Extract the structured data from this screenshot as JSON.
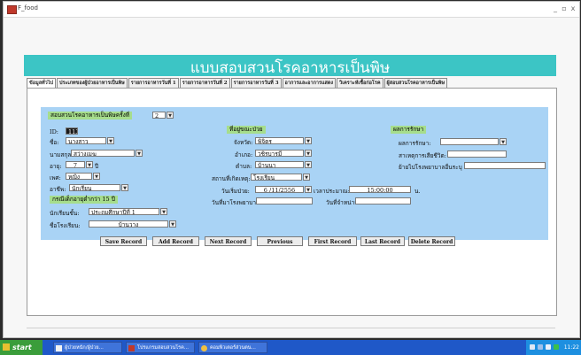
{
  "window": {
    "title": "F_food",
    "min_glyph": "_",
    "max_glyph": "▫",
    "close_glyph": "x"
  },
  "header": {
    "title": "แบบสอบสวนโรคอาหารเป็นพิษ"
  },
  "tabs": [
    "ข้อมูลทั่วไป",
    "ประเภทของผู้ป่วยอาหารเป็นพิษ",
    "รายการอาหารวันที่ 1",
    "รายการอาหารวันที่ 2",
    "รายการอาหารวันที่ 3",
    "อาการและอาการแสดง",
    "วิเคราะห์เชื้อก่อโรค",
    "ผู้สอบสวนโรคอาหารเป็นพิษ"
  ],
  "form": {
    "investigation_count_label": "สอบสวนโรคอาหารเป็นพิษครั้งที่",
    "investigation_count_value": "2",
    "id_label": "ID:",
    "id_value": "113",
    "prefix_label": "ชื่อ:",
    "prefix_value": "นางสาว",
    "lastname_label": "นามสกุล:",
    "lastname_value": "สว่างเมฆ",
    "age_label": "อายุ:",
    "age_value": "7",
    "age_unit": "ปี",
    "sex_label": "เพศ:",
    "sex_value": "หญิง",
    "occupation_label": "อาชีพ:",
    "occupation_value": "นักเรียน",
    "under15_header": "กรณีเด็กอายุต่ำกว่า 15 ปี",
    "student_level_label": "นักเรียนชั้น:",
    "student_level_value": "ประถมศึกษาปีที่ 1",
    "school_label": "ชื่อโรงเรียน:",
    "school_value": "บ้านวาง",
    "address_header": "ที่อยู่ขณะป่วย",
    "province_label": "จังหวัด:",
    "province_value": "พิจิตร",
    "district_label": "อำเภอ:",
    "district_value": "วชิรบารมี",
    "subdistrict_label": "ตำบล:",
    "subdistrict_value": "บ้านนา",
    "place_label": "สถานที่เกิดเหตุ:",
    "place_value": "โรงเรียน",
    "onset_date_label": "วันเริ่มป่วย:",
    "onset_date_value": "6 /11/2556",
    "onset_time_label": "เวลาประมาณ:",
    "onset_time_value": "15:00:00",
    "onset_time_unit": "น.",
    "hospital_date_label": "วันที่มาโรงพยาบาล:",
    "hospital_date_value": "",
    "discharge_date_label": "วันที่จำหน่าย:",
    "discharge_date_value": "",
    "treatment_header": "ผลการรักษา",
    "treatment_result_label": "ผลการรักษา:",
    "treatment_result_value": "",
    "death_cause_label": "สาเหตุการเสียชีวิต:",
    "death_cause_value": "",
    "transfer_label": "ย้ายไปโรงพยาบาลอื่นระบุ",
    "transfer_value": ""
  },
  "buttons": {
    "save": "Save Record",
    "add": "Add Record",
    "next": "Next Record",
    "previous": "Previous",
    "first": "First Record",
    "last": "Last Record",
    "delete": "Delete Record"
  },
  "taskbar": {
    "start": "start",
    "tasks": [
      "ผู้ป่วยหนัก/ผู้ป่วย...",
      "โปรแกรมสอบสวนโรค...",
      "คอมพิวเตอร์ส่วนตน..."
    ],
    "clock": "11:22"
  },
  "colors": {
    "header": "#3cc5c5",
    "form_bg": "#a9d3f5",
    "section_bg": "#a6dd8c",
    "taskbar": "#1f58c8"
  }
}
